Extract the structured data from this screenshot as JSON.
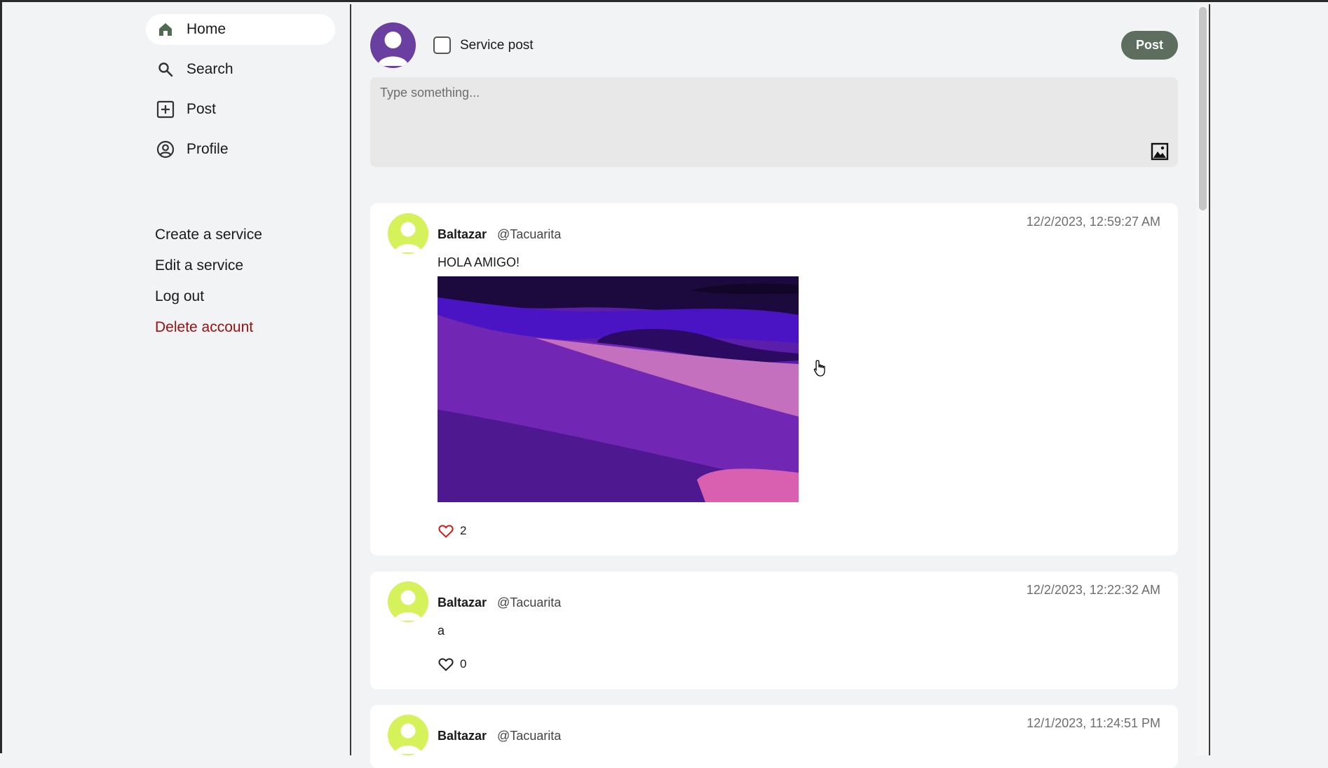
{
  "sidebar": {
    "nav": [
      {
        "label": "Home",
        "icon": "home-icon",
        "active": true
      },
      {
        "label": "Search",
        "icon": "search-icon"
      },
      {
        "label": "Post",
        "icon": "plus-square-icon"
      },
      {
        "label": "Profile",
        "icon": "user-circle-icon"
      }
    ],
    "menu": {
      "create_service": "Create a service",
      "edit_service": "Edit a service",
      "log_out": "Log out",
      "delete_account": "Delete account"
    }
  },
  "composer": {
    "service_post_label": "Service post",
    "service_post_checked": false,
    "post_button": "Post",
    "placeholder": "Type something...",
    "value": ""
  },
  "posts": [
    {
      "author": "Baltazar",
      "handle": "@Tacuarita",
      "timestamp": "12/2/2023, 12:59:27 AM",
      "text": "HOLA AMIGO!",
      "has_image": true,
      "likes": "2",
      "liked": true
    },
    {
      "author": "Baltazar",
      "handle": "@Tacuarita",
      "timestamp": "12/2/2023, 12:22:32 AM",
      "text": "a",
      "has_image": false,
      "likes": "0",
      "liked": false
    },
    {
      "author": "Baltazar",
      "handle": "@Tacuarita",
      "timestamp": "12/1/2023, 11:24:51 PM"
    }
  ],
  "colors": {
    "background": "#f1f3f4",
    "post_button": "#5d6e5f",
    "delete_text": "#9a0f0f",
    "composer_avatar": "#6b3fa0",
    "post_avatar": "#d6f25a",
    "liked_heart": "#d11a1a"
  }
}
